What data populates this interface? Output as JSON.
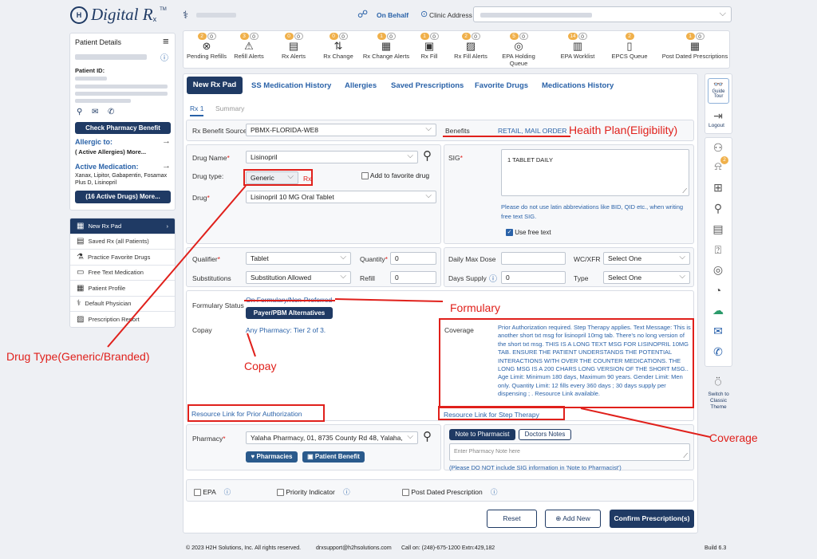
{
  "header": {
    "logo_text": "Digital R",
    "logo_sub": "x",
    "logo_tm": "TM",
    "on_behalf": "On Behalf",
    "clinic_label": "Clinic Address"
  },
  "alerts": [
    {
      "b1": "2",
      "b2": "0",
      "label": "Pending Refills",
      "icon": "⊗"
    },
    {
      "b1": "3",
      "b2": "0",
      "label": "Refill Alerts",
      "icon": "⚠"
    },
    {
      "b1": "0",
      "b2": "0",
      "label": "Rx Alerts",
      "icon": "▤"
    },
    {
      "b1": "0",
      "b2": "0",
      "label": "Rx Change",
      "icon": "⇅"
    },
    {
      "b1": "1",
      "b2": "0",
      "label": "Rx Change Alerts",
      "icon": "▦"
    },
    {
      "b1": "1",
      "b2": "0",
      "label": "Rx Fill",
      "icon": "▣"
    },
    {
      "b1": "2",
      "b2": "0",
      "label": "Rx Fill Alerts",
      "icon": "▨"
    },
    {
      "b1": "5",
      "b2": "0",
      "label": "EPA Holding Queue",
      "icon": "◎"
    },
    {
      "b1": "14",
      "b2": "0",
      "label": "EPA Worklist",
      "icon": "▥"
    },
    {
      "b1": "2",
      "b2": "",
      "label": "EPCS Queue",
      "icon": "▯"
    },
    {
      "b1": "1",
      "b2": "0",
      "label": "Post Dated Prescriptions",
      "icon": "▦"
    }
  ],
  "patient": {
    "title": "Patient Details",
    "id_label": "Patient ID:",
    "check_pharmacy": "Check Pharmacy Benefit",
    "allergic_to": "Allergic to:",
    "active_allergies": "( Active Allergies) More...",
    "active_med": "Active Medication:",
    "med_list": "Xanax, Lipitor, Gabapentin, Fosamax Plus D, Lisinopril",
    "active_drugs_btn": "(16 Active Drugs) More..."
  },
  "sidebar_menu": [
    "New Rx Pad",
    "Saved Rx (all Patients)",
    "Practice Favorite Drugs",
    "Free Text Medication",
    "Patient Profile",
    "Default Physician",
    "Prescription Report"
  ],
  "tabs": [
    "New Rx Pad",
    "SS Medication History",
    "Allergies",
    "Saved Prescriptions",
    "Favorite Drugs",
    "Medications History"
  ],
  "subtabs": [
    "Rx 1",
    "Summary"
  ],
  "form": {
    "rx_benefit_label": "Rx Benefit Source",
    "rx_benefit_value": "PBMX-FLORIDA-WE8",
    "benefits_label": "Benefits",
    "benefits_value": "RETAIL, MAIL ORDER",
    "drug_name_label": "Drug Name",
    "drug_name_value": "Lisinopril",
    "drug_type_label": "Drug type:",
    "drug_type_value": "Generic",
    "rx_tag": "Rx",
    "add_fav": "Add to favorite drug",
    "drug_label": "Drug",
    "drug_value": "Lisinopril 10 MG Oral Tablet",
    "sig_label": "SIG",
    "sig_value": "1 TABLET DAILY",
    "sig_note": "Please do not use latin abbreviations like BID, QID etc., when writing free text SIG.",
    "use_free_text": "Use free text",
    "qualifier_label": "Qualifier",
    "qualifier_value": "Tablet",
    "quantity_label": "Quantity",
    "quantity_value": "0",
    "substitutions_label": "Substitutions",
    "substitutions_value": "Substitution Allowed",
    "refill_label": "Refill",
    "refill_value": "0",
    "daily_max_label": "Daily Max Dose",
    "wc_label": "WC/XFR",
    "wc_value": "Select One",
    "days_supply_label": "Days Supply",
    "days_supply_value": "0",
    "type_label": "Type",
    "type_value": "Select One",
    "formulary_label": "Formulary Status",
    "formulary_value": "On Formulary/Non-Preferred",
    "payer_btn": "Payer/PBM Alternatives",
    "copay_label": "Copay",
    "copay_value": "Any Pharmacy: Tier 2 of 3.",
    "coverage_label": "Coverage",
    "coverage_text": "Prior Authorization required. Step Therapy applies. Text Message: This is another short txt msg for lisinopril 10mg tab. There's no long version of the short txt msg. THIS IS A LONG TEXT MSG FOR LISINOPRIL 10MG TAB. ENSURE THE PATIENT UNDERSTANDS THE POTENTIAL INTERACTIONS WITH OVER THE COUNTER MEDICATIONS. THE LONG MSG IS A 200 CHARS LONG VERSION OF THE SHORT MSG.. Age Limit: Minimum 180 days, Maximum 90 years. Gender Limit: Men only. Quantity Limit: 12 fills every 360 days ; 30 days supply per dispensing ; . Resource Link available.",
    "prior_auth_link": "Resource Link for Prior Authorization",
    "step_therapy_link": "Resource Link for Step Therapy",
    "pharmacy_label": "Pharmacy",
    "pharmacy_value": "Yalaha Pharmacy, 01, 8735 County Rd 48, Yalaha,",
    "pharmacies_btn": "Pharmacies",
    "patient_benefit_btn": "Patient Benefit",
    "note_tab": "Note to Pharmacist",
    "doctors_tab": "Doctors Notes",
    "note_placeholder": "Enter Pharmacy Note here",
    "note_warning": "(Please DO NOT include SIG information in 'Note to Pharmacist')",
    "epa": "EPA",
    "priority": "Priority Indicator",
    "post_dated": "Post Dated Prescription",
    "reset": "Reset",
    "add_new": "Add New",
    "confirm": "Confirm Prescription(s)"
  },
  "right_rail": {
    "guide": "Guide Tour",
    "logout": "Logout",
    "badge": "2",
    "switch": "Switch to Classic Theme"
  },
  "annotations": {
    "health_plan": "Heaith Plan(Eligibility)",
    "formulary": "Formulary",
    "drug_type": "Drug Type(Generic/Branded)",
    "copay": "Copay",
    "coverage": "Coverage"
  },
  "footer": {
    "copyright": "© 2023 H2H Solutions, Inc. All rights reserved.",
    "email": "drxsupport@h2hsolutions.com",
    "call": "Call on: (248)-675-1200 Extn:429,182",
    "build": "Build 6.3"
  },
  "colors": {
    "navy": "#1f3a64",
    "link": "#2a62a8",
    "annotation": "#e0201b",
    "badge": "#f0b04a"
  }
}
